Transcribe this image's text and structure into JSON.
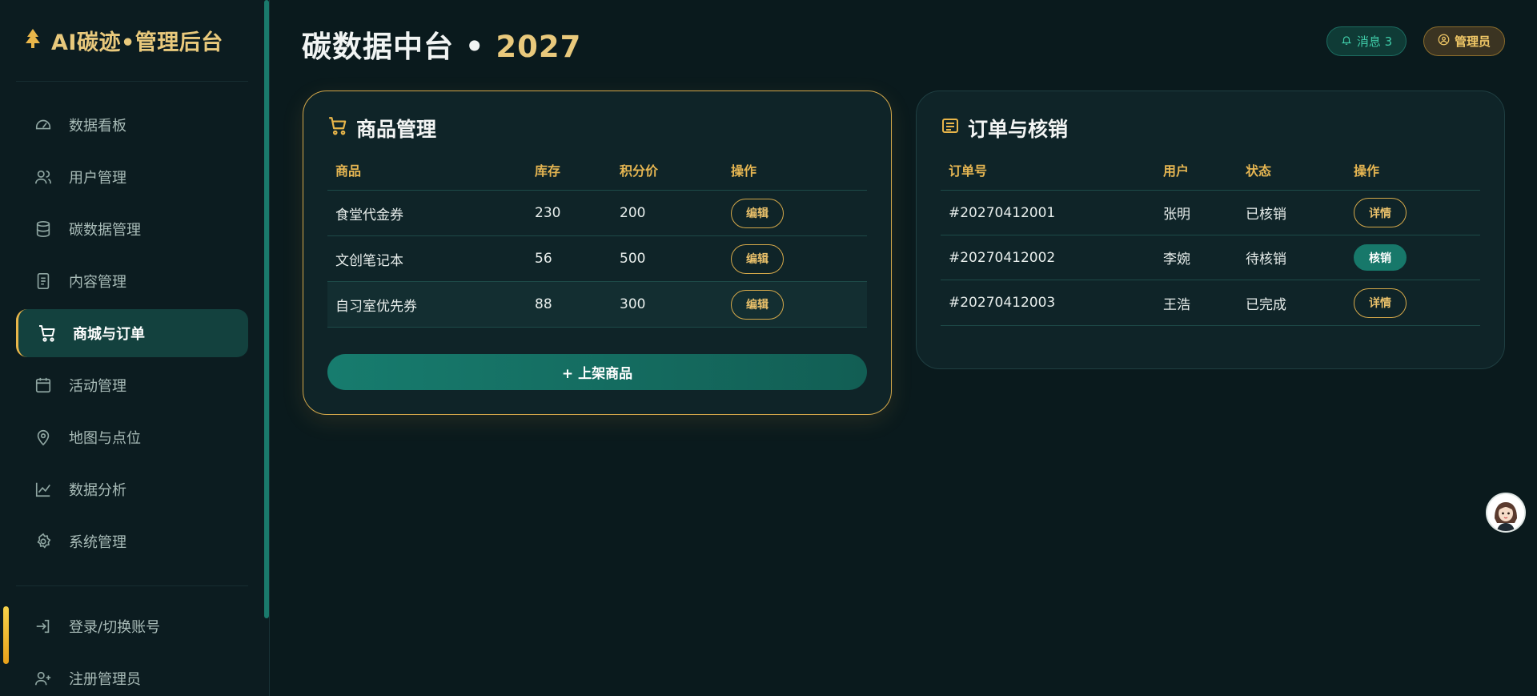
{
  "brand": {
    "icon": "tree-icon",
    "title": "AI碳迹•管理后台"
  },
  "nav": [
    {
      "label": "数据看板",
      "icon": "dashboard-gauge-icon",
      "active": false
    },
    {
      "label": "用户管理",
      "icon": "users-icon",
      "active": false
    },
    {
      "label": "碳数据管理",
      "icon": "database-icon",
      "active": false
    },
    {
      "label": "内容管理",
      "icon": "document-icon",
      "active": false
    },
    {
      "label": "商城与订单",
      "icon": "shopping-cart-icon",
      "active": true
    },
    {
      "label": "活动管理",
      "icon": "calendar-icon",
      "active": false
    },
    {
      "label": "地图与点位",
      "icon": "map-pin-icon",
      "active": false
    },
    {
      "label": "数据分析",
      "icon": "line-chart-icon",
      "active": false
    },
    {
      "label": "系统管理",
      "icon": "gear-icon",
      "active": false
    }
  ],
  "nav_bottom": [
    {
      "label": "登录/切换账号",
      "icon": "login-icon"
    },
    {
      "label": "注册管理员",
      "icon": "user-plus-icon"
    }
  ],
  "header": {
    "title_main": "碳数据中台 • ",
    "title_year": "2027",
    "messages_label": "消息 3",
    "admin_label": "管理员"
  },
  "goods": {
    "title": "商品管理",
    "columns": [
      "商品",
      "库存",
      "积分价",
      "操作"
    ],
    "rows": [
      {
        "name": "食堂代金券",
        "stock": "230",
        "price": "200",
        "action": "编辑"
      },
      {
        "name": "文创笔记本",
        "stock": "56",
        "price": "500",
        "action": "编辑"
      },
      {
        "name": "自习室优先券",
        "stock": "88",
        "price": "300",
        "action": "编辑"
      }
    ],
    "add_label": "+ 上架商品"
  },
  "orders": {
    "title": "订单与核销",
    "columns": [
      "订单号",
      "用户",
      "状态",
      "操作"
    ],
    "rows": [
      {
        "id": "#20270412001",
        "user": "张明",
        "status": "已核销",
        "action": "详情",
        "primary": false
      },
      {
        "id": "#20270412002",
        "user": "李婉",
        "status": "待核销",
        "action": "核销",
        "primary": true
      },
      {
        "id": "#20270412003",
        "user": "王浩",
        "status": "已完成",
        "action": "详情",
        "primary": false
      }
    ]
  },
  "colors": {
    "accent_gold": "#e9c97c",
    "accent_teal": "#17786a",
    "background": "#0a1a1d"
  }
}
